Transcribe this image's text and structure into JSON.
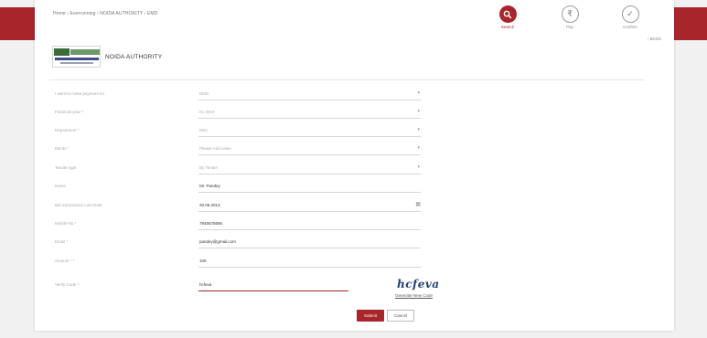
{
  "breadcrumb": "Home › Everrunning › NOIDA AUTHORITY › EMD",
  "steps": [
    {
      "label": "Search",
      "icon": "search-icon",
      "active": true
    },
    {
      "label": "Pay",
      "icon": "rupee-icon",
      "active": false
    },
    {
      "label": "Confirm",
      "icon": "check-icon",
      "active": false
    }
  ],
  "back_label": "‹ BACK",
  "org_name": "NOIDA AUTHORITY",
  "form": {
    "payment_for": {
      "label": "I want to make payment for",
      "value": "EMD"
    },
    "financial_year": {
      "label": "Financial year *",
      "value": "01-2019"
    },
    "department": {
      "label": "Department *",
      "value": "DEC"
    },
    "bid_id": {
      "label": "Bid ID *",
      "value": "Please Add value"
    },
    "tender_type": {
      "label": "Tender type",
      "value": "By Tender"
    },
    "name": {
      "label": "Name",
      "value": "Mr. Pandey"
    },
    "bid_date": {
      "label": "Bid Submission Last Date",
      "value": "20.08.2013"
    },
    "mobile": {
      "label": "Mobile No *",
      "value": "7945575695"
    },
    "email": {
      "label": "Email *",
      "value": "pandey@gmail.com"
    },
    "amount": {
      "label": "Amount * *",
      "value": "100"
    },
    "verify": {
      "label": "Verify Code *",
      "value": "hcfeva"
    }
  },
  "captcha_text": "hcfeva",
  "regenerate_label": "Generate New Code",
  "submit_label": "Submit",
  "cancel_label": "Cancel",
  "colors": {
    "accent": "#a8252b"
  }
}
